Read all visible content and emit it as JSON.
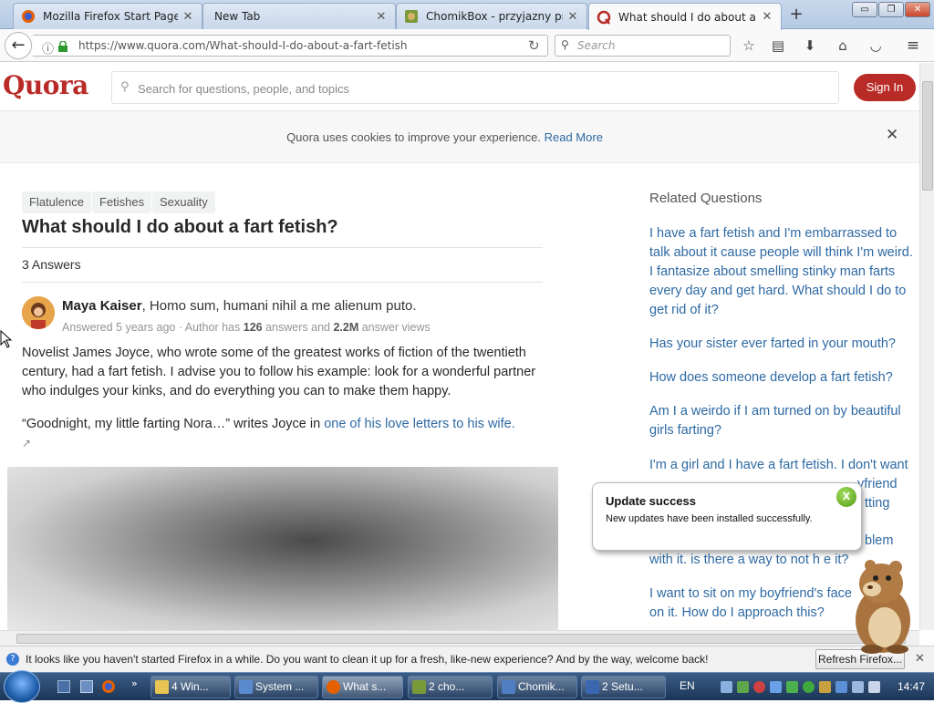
{
  "browser": {
    "tabs": [
      {
        "title": "Mozilla Firefox Start Page",
        "icon": "firefox-icon"
      },
      {
        "title": "New Tab",
        "icon": "blank-icon"
      },
      {
        "title": "ChomikBox - przyjazny pro...",
        "icon": "chomik-icon"
      },
      {
        "title": "What should I do about a f...",
        "icon": "quora-icon"
      }
    ],
    "window_buttons": [
      "▭",
      "❐",
      "✕"
    ],
    "url_host": "https://www.quora.com",
    "url_path": "/What-should-I-do-about-a-fart-fetish",
    "search_placeholder": "Search"
  },
  "quora": {
    "logo": "Quora",
    "search_placeholder": "Search for questions, people, and topics",
    "signin_label": "Sign In",
    "cookie_text": "Quora uses cookies to improve your experience.",
    "cookie_link": "Read More",
    "topics": [
      "Flatulence",
      "Fetishes",
      "Sexuality"
    ],
    "question": "What should I do about a fart fetish?",
    "answers_count": "3 Answers",
    "answer": {
      "author": "Maya Kaiser",
      "tagline": ", Homo sum, humani nihil a me alienum puto.",
      "meta_prefix": "Answered 5 years ago · Author has",
      "answer_count": "126",
      "meta_mid": "answers and",
      "views": "2.2M",
      "meta_suffix": "answer views",
      "paragraph1": "Novelist James Joyce, who wrote some of the greatest works of fiction of the twentieth century, had a fart fetish. I advise you to follow his example: look for a wonderful partner who indulges your kinks, and do everything you can to make them happy.",
      "paragraph2_prefix": "“Goodnight, my little farting Nora…” writes Joyce in",
      "paragraph2_link": "one of his love letters to his wife."
    },
    "related_heading": "Related Questions",
    "related": [
      "I have a fart fetish and I'm embarrassed to talk about it cause people will think I'm weird. I fantasize about smelling stinky man farts every day and get hard. What should I do to get rid of it?",
      "Has your sister ever farted in your mouth?",
      "How does someone develop a fart fetish?",
      "Am I a weirdo if I am turned on by beautiful girls farting?",
      "I'm a girl and I have a fart fetish. I don't want",
      "blem",
      "with it. is there a way to not h  e it?",
      "I want to sit on my boyfriend's face",
      "on it. How do I approach this?"
    ],
    "partial_fragments": [
      "yfriend",
      "tting"
    ]
  },
  "notification": {
    "title": "Update success",
    "body": "New updates have been installed successfully.",
    "close": "X"
  },
  "infobar": {
    "text": "It looks like you haven't started Firefox in a while. Do you want to clean it up for a fresh, like-new experience? And by the way, welcome back!",
    "button": "Refresh Firefox...",
    "close": "✕"
  },
  "taskbar": {
    "items": [
      "4 Win...",
      "System ...",
      "What s...",
      "2 cho...",
      "Chomik...",
      "2 Setu..."
    ],
    "lang": "EN",
    "clock": "14:47"
  }
}
